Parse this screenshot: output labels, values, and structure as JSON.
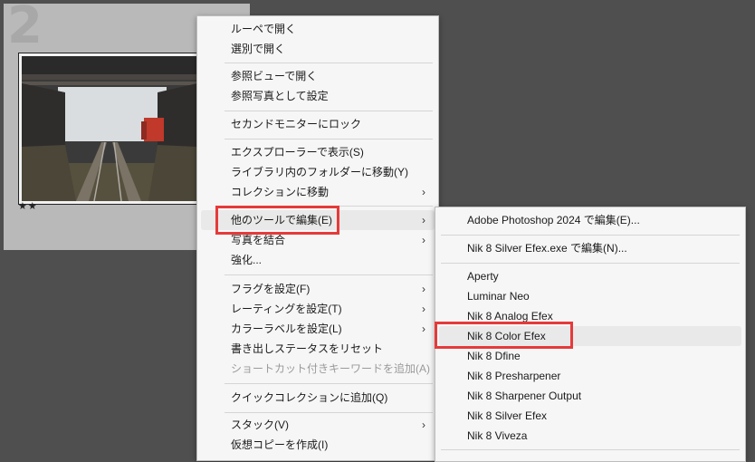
{
  "grid": {
    "cell_index": "2",
    "stars": "★★"
  },
  "context_menu": {
    "items": {
      "loupe": "ルーペで開く",
      "survey": "選別で開く",
      "reference_view": "参照ビューで開く",
      "set_reference": "参照写真として設定",
      "lock_second_monitor": "セカンドモニターにロック",
      "show_in_explorer": "エクスプローラーで表示(S)",
      "go_to_folder": "ライブラリ内のフォルダーに移動(Y)",
      "go_to_collection": "コレクションに移動",
      "edit_in": "他のツールで編集(E)",
      "merge_photo": "写真を結合",
      "enhance": "強化...",
      "set_flag": "フラグを設定(F)",
      "set_rating": "レーティングを設定(T)",
      "set_color_label": "カラーラベルを設定(L)",
      "reset_export_status": "書き出しステータスをリセット",
      "add_shortcut_keyword": "ショートカット付きキーワードを追加(A)",
      "add_to_quick_collection": "クイックコレクションに追加(Q)",
      "stacking": "スタック(V)",
      "create_virtual_copy": "仮想コピーを作成(I)"
    },
    "arrow": "›"
  },
  "submenu": {
    "items": [
      "Adobe Photoshop 2024 で編集(E)...",
      "Nik 8 Silver Efex.exe で編集(N)...",
      "Aperty",
      "Luminar Neo",
      "Nik 8 Analog Efex",
      "Nik 8 Color Efex",
      "Nik 8 Dfine",
      "Nik 8 Presharpener",
      "Nik 8 Sharpener Output",
      "Nik 8 Silver Efex",
      "Nik 8 Viveza"
    ]
  },
  "highlight_color": "#e63a3a"
}
